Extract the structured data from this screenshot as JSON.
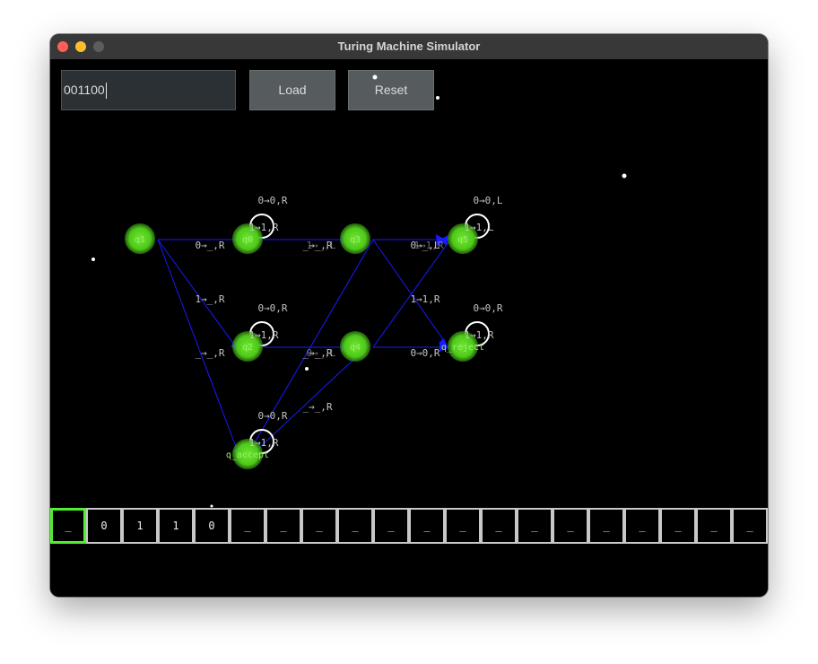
{
  "window": {
    "title": "Turing Machine Simulator"
  },
  "toolbar": {
    "input_value": "001100",
    "load_label": "Load",
    "reset_label": "Reset"
  },
  "states": {
    "q1": "q1",
    "q0": "q0",
    "q3": "q3",
    "q5": "q5",
    "q2": "q2",
    "q4": "q4",
    "q_reject": "q_reject",
    "q_accept": "q_accept"
  },
  "transitions": {
    "q0_self_top": "0→0,R",
    "q0_self_bottom": "1→1,R",
    "q5_self_top": "0→0,L",
    "q5_self_bottom": "1→1,L",
    "q2_self_top": "0→0,R",
    "q2_self_bottom": "1→1,R",
    "qrej_self_top": "0→0,R",
    "qrej_self_bottom": "1→1,R",
    "qacc_self_top": "0→0,R",
    "qacc_self_bottom": "1→1,R",
    "q1_q0": "0→_,R",
    "q1_q2": "1→_,R",
    "q1_qacc": "_→_,R",
    "q0_q3": "_→_,R",
    "q0_q3_b": "1→_,L",
    "q2_q4": "_→_,R",
    "q2_q4_b": "0→_,L",
    "q3_q5": "0→_,L",
    "q3_q5_b": "1→1,R",
    "q4_q5": "1→1,R",
    "q4_qrej": "0→0,R",
    "q4_qacc": "_→_,R"
  },
  "tape": {
    "cells": [
      "_",
      "0",
      "1",
      "1",
      "0",
      "_",
      "_",
      "_",
      "_",
      "_",
      "_",
      "_",
      "_",
      "_",
      "_",
      "_",
      "_",
      "_",
      "_",
      "_"
    ],
    "head_index": 0
  },
  "colors": {
    "node": "#55d41e",
    "node_label": "#98f070",
    "edge": "#1a1aff",
    "loop": "#ffffff",
    "edge_label": "#c4c4c4",
    "head": "#50f030"
  }
}
